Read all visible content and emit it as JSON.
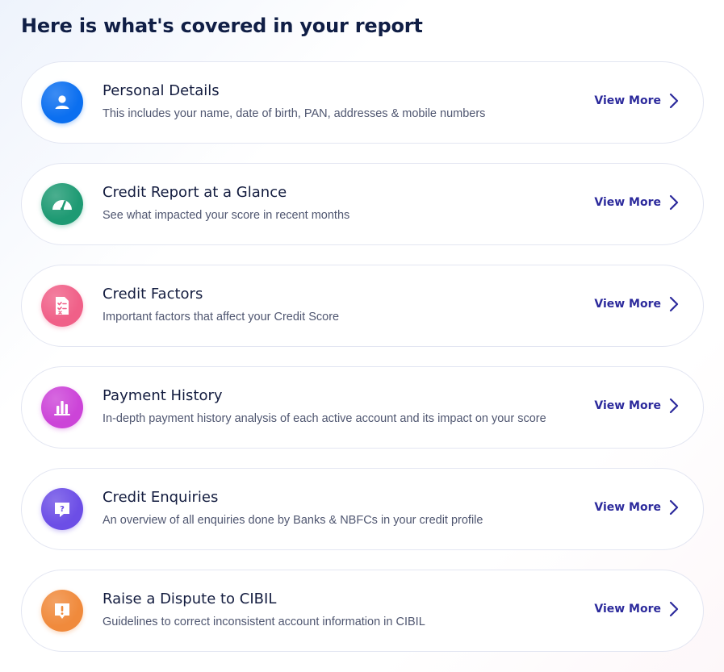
{
  "heading": "Here is what's covered in your report",
  "view_more_label": "View More",
  "cards": [
    {
      "title": "Personal Details",
      "description": "This includes your name, date of birth, PAN, addresses & mobile numbers",
      "icon": "user-icon",
      "color": "#0b6ff0"
    },
    {
      "title": "Credit Report at a Glance",
      "description": "See what impacted your score in recent months",
      "icon": "speedometer-icon",
      "color": "#1e9a73"
    },
    {
      "title": "Credit Factors",
      "description": "Important factors that affect your Credit Score",
      "icon": "checklist-document-icon",
      "color": "#f06088"
    },
    {
      "title": "Payment History",
      "description": "In-depth payment history analysis of each active account and its impact on your score",
      "icon": "bar-chart-icon",
      "color": "#cc44d8"
    },
    {
      "title": "Credit Enquiries",
      "description": "An overview of all enquiries done by Banks & NBFCs in your credit profile",
      "icon": "question-bubble-icon",
      "color": "#6c4ee6"
    },
    {
      "title": "Raise a Dispute to CIBIL",
      "description": "Guidelines to correct inconsistent account information in CIBIL",
      "icon": "alert-bubble-icon",
      "color": "#f08a3c"
    }
  ]
}
